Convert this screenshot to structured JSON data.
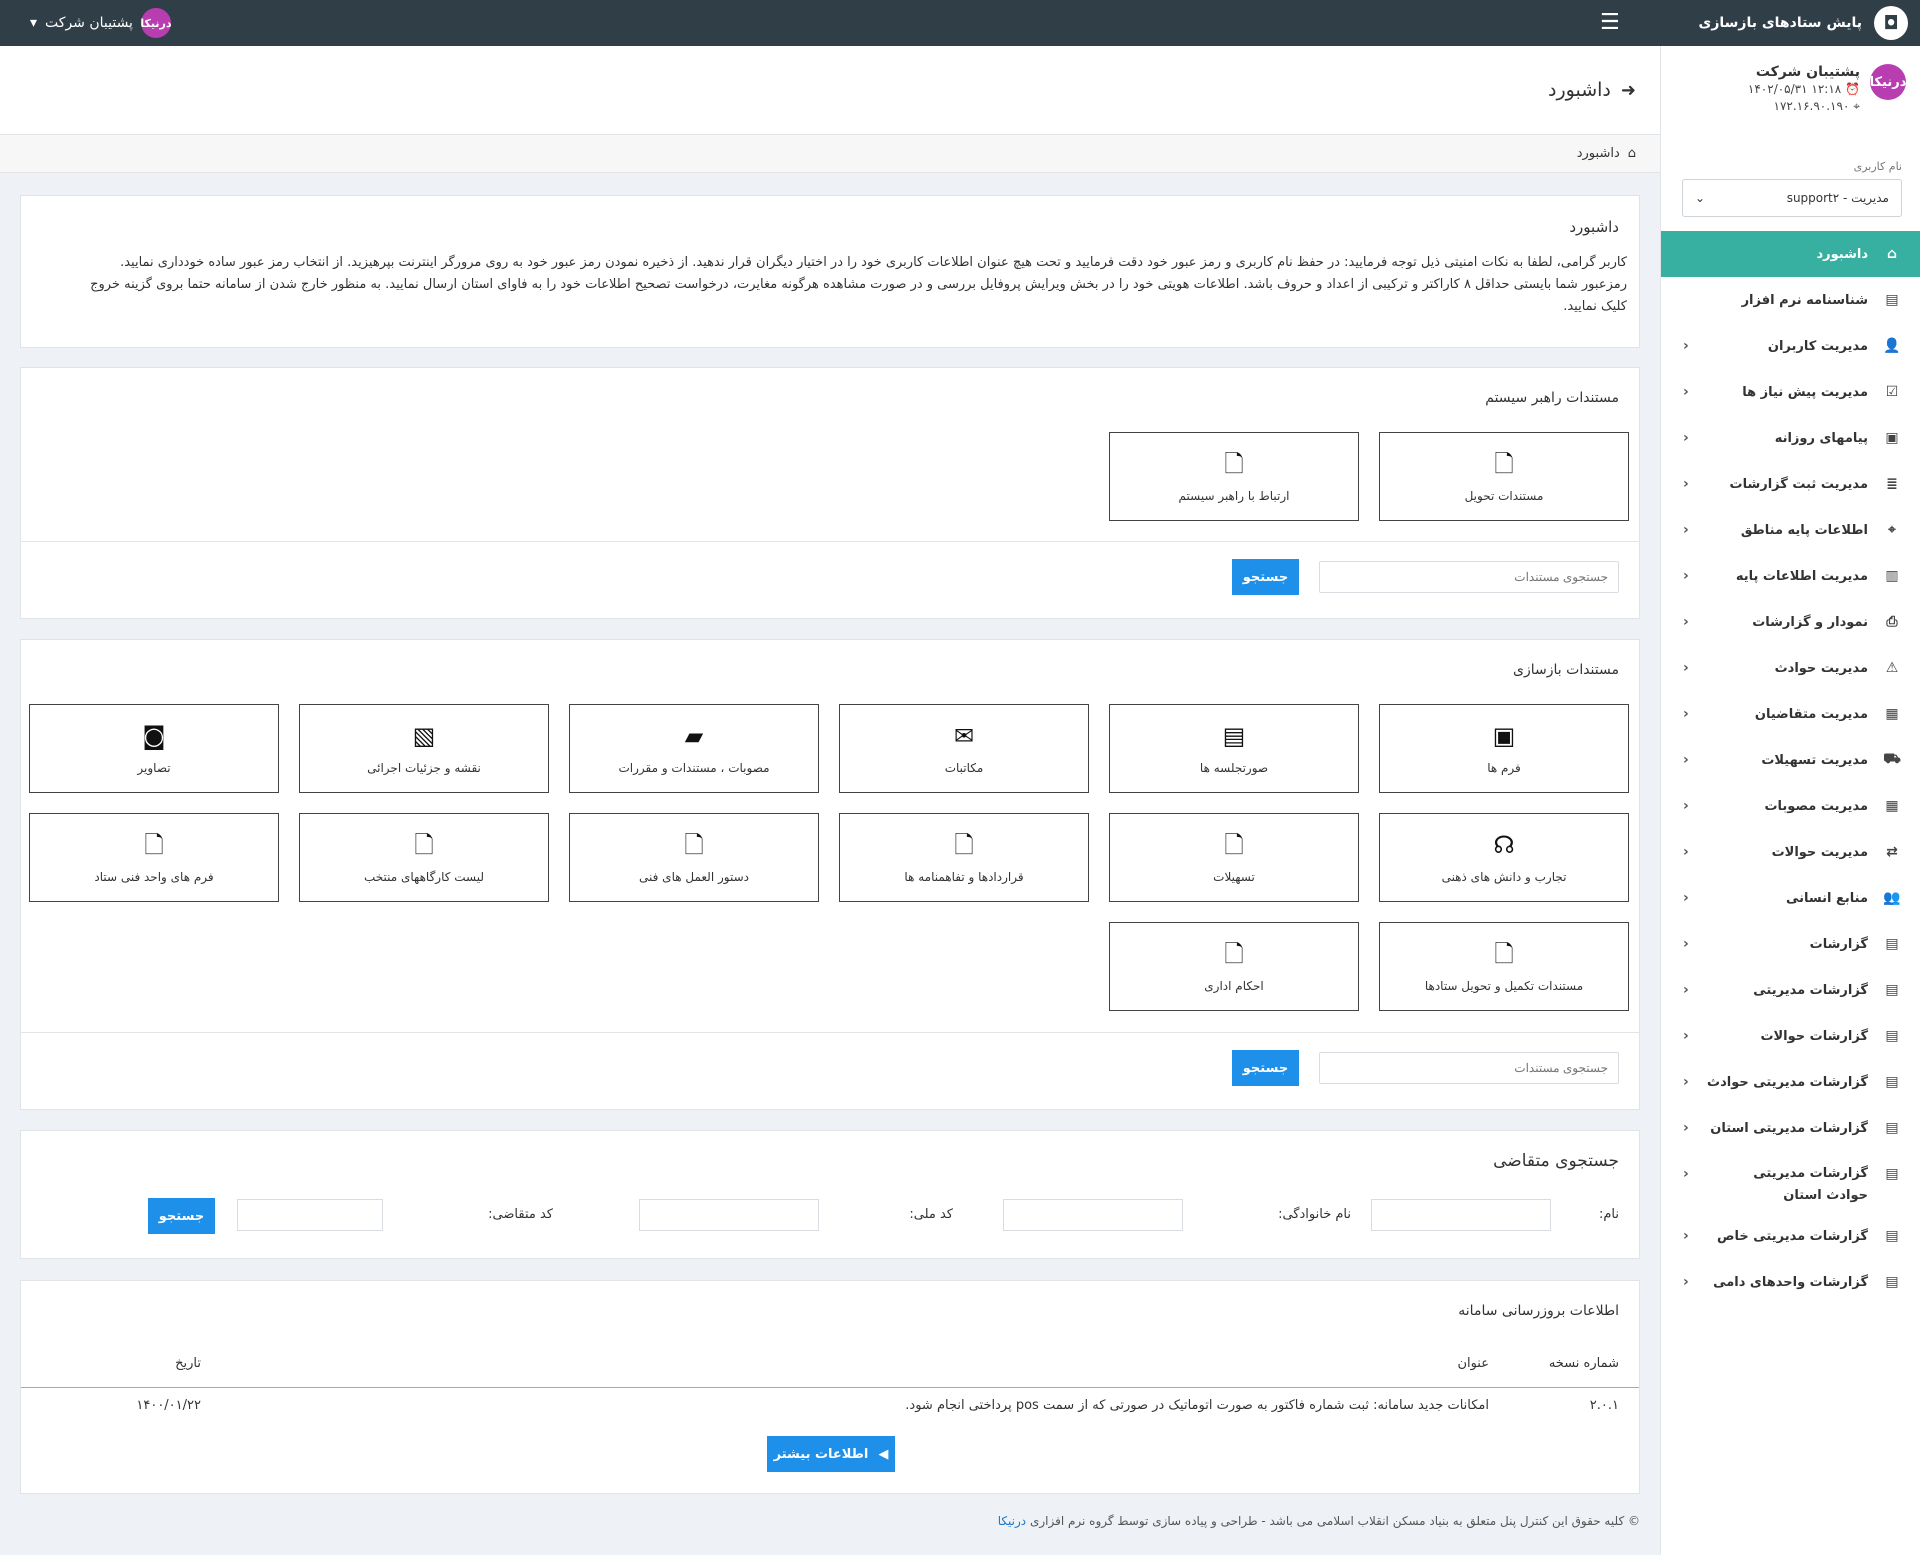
{
  "topbar": {
    "brand_title": "پایش ستادهای بازسازی",
    "brand_logo": "logo-icon",
    "menu_icon": "hamburger-icon",
    "user_name": "پشتیبان شرکت",
    "user_logo_text": "درنیکا"
  },
  "sidebar": {
    "profile_name": "پشتیبان شرکت",
    "profile_datetime": "۱۲:۱۸ ۱۴۰۲/۰۵/۳۱",
    "profile_ip": "۱۷۲.۱۶.۹۰.۱۹۰",
    "username_label": "نام کاربری",
    "user_select_value": "مدیریت - support۲",
    "items": [
      {
        "label": "داشبورد",
        "icon": "home-icon",
        "active": true,
        "arrow": false
      },
      {
        "label": "شناسنامه نرم افزار",
        "icon": "id-card-icon",
        "arrow": false
      },
      {
        "label": "مدیریت کاربران",
        "icon": "users-icon",
        "arrow": true
      },
      {
        "label": "مدیریت پیش نیاز ها",
        "icon": "clipboard-icon",
        "arrow": true
      },
      {
        "label": "پیامهای روزانه",
        "icon": "message-icon",
        "arrow": true
      },
      {
        "label": "مدیریت ثبت گزارشات",
        "icon": "server-icon",
        "arrow": true
      },
      {
        "label": "اطلاعات پایه مناطق",
        "icon": "map-pin-icon",
        "arrow": true
      },
      {
        "label": "مدیریت اطلاعات پایه",
        "icon": "database-icon",
        "arrow": true
      },
      {
        "label": "نمودار و گزارشات",
        "icon": "printer-icon",
        "arrow": true
      },
      {
        "label": "مدیریت حوادث",
        "icon": "incident-icon",
        "arrow": true
      },
      {
        "label": "مدیریت متقاضیان",
        "icon": "applicants-icon",
        "arrow": true
      },
      {
        "label": "مدیریت تسهیلات",
        "icon": "facility-icon",
        "arrow": true
      },
      {
        "label": "مدیریت مصوبات",
        "icon": "approvals-icon",
        "arrow": true
      },
      {
        "label": "مدیریت حوالات",
        "icon": "transfer-icon",
        "arrow": true
      },
      {
        "label": "منابع انسانی",
        "icon": "people-icon",
        "arrow": true
      },
      {
        "label": "گزارشات",
        "icon": "report-icon",
        "arrow": true
      },
      {
        "label": "گزارشات مدیریتی",
        "icon": "report-icon",
        "arrow": true
      },
      {
        "label": "گزارشات حوالات",
        "icon": "report-icon",
        "arrow": true
      },
      {
        "label": "گزارشات مدیریتی حوادث",
        "icon": "report-icon",
        "arrow": true
      },
      {
        "label": "گزارشات مدیریتی استان",
        "icon": "report-icon",
        "arrow": true
      },
      {
        "label": "گزارشات مدیریتی حوادث استان",
        "icon": "report-icon",
        "arrow": true,
        "tall": true
      },
      {
        "label": "گزارشات مدیریتی خاص",
        "icon": "report-icon",
        "arrow": true
      },
      {
        "label": "گزارشات واحدهای دامی",
        "icon": "report-icon",
        "arrow": true
      }
    ]
  },
  "header": {
    "title": "داشبورد",
    "breadcrumb": "داشبورد"
  },
  "notice": {
    "title": "داشبورد",
    "line1": "کاربر گرامی، لطفا به نکات امنیتی ذیل توجه فرمایید: در حفظ نام کاربری و رمز عبور خود دقت فرمایید و تحت هیچ عنوان اطلاعات کاربری خود را در اختیار دیگران قرار ندهید. از ذخیره نمودن رمز عبور خود به روی مرورگر اینترنت بپرهیزید. از انتخاب رمز عبور ساده خودداری نمایید.",
    "line2": "رمزعبور شما بایستی حداقل ۸ کاراکتر و ترکیبی از اعداد و حروف باشد. اطلاعات هویتی خود را در بخش ویرایش پروفایل بررسی و در صورت مشاهده هرگونه مغایرت، درخواست تصحیح اطلاعات خود را به فاوای استان ارسال نمایید. به منظور خارج شدن از سامانه حتما بروی گزینه خروج",
    "line3": "کلیک نمایید."
  },
  "guide_docs": {
    "title": "مستندات راهبر سیستم",
    "tiles": [
      {
        "label": "مستندات تحویل",
        "icon": "document-icon"
      },
      {
        "label": "ارتباط با راهبر سیستم",
        "icon": "document-icon"
      }
    ],
    "search_placeholder": "جستجوی مستندات",
    "search_button": "جستجو"
  },
  "rebuild_docs": {
    "title": "مستندات بازسازی",
    "tiles": [
      {
        "label": "فرم ها",
        "icon": "contact-card-icon"
      },
      {
        "label": "صورتجلسه ها",
        "icon": "newspaper-icon"
      },
      {
        "label": "مکاتبات",
        "icon": "envelope-icon"
      },
      {
        "label": "مصوبات ، مستندات و مقررات",
        "icon": "folder-open-icon"
      },
      {
        "label": "نقشه و جزئیات اجرائی",
        "icon": "map-book-icon"
      },
      {
        "label": "تصاویر",
        "icon": "camera-icon"
      },
      {
        "label": "تجارب و دانش های ذهنی",
        "icon": "brain-head-icon"
      },
      {
        "label": "تسهیلات",
        "icon": "document-icon"
      },
      {
        "label": "قراردادها و تفاهمنامه ها",
        "icon": "document-icon"
      },
      {
        "label": "دستور العمل های فنی",
        "icon": "document-icon"
      },
      {
        "label": "لیست کارگاههای منتخب",
        "icon": "document-icon"
      },
      {
        "label": "فرم های واحد فنی ستاد",
        "icon": "document-icon"
      },
      {
        "label": "مستندات تکمیل و تحویل ستادها",
        "icon": "document-icon"
      },
      {
        "label": "احکام اداری",
        "icon": "document-icon"
      }
    ],
    "search_placeholder": "جستجوی مستندات",
    "search_button": "جستجو"
  },
  "applicant_search": {
    "title": "جستجوی متقاضی",
    "name_label": "نام:",
    "family_label": "نام خانوادگی:",
    "national_code_label": "کد ملی:",
    "applicant_code_label": "کد متقاضی:",
    "search_button": "جستجو"
  },
  "updates": {
    "title": "اطلاعات بروزرسانی سامانه",
    "col_version": "شماره نسخه",
    "col_title": "عنوان",
    "col_date": "تاریخ",
    "row_version": "۲.۰.۱",
    "row_title": "امکانات جدید سامانه: ثبت شماره فاکتور به صورت اتوماتیک در صورتی که از سمت pos پرداختی انجام شود.",
    "row_date": "۱۴۰۰/۰۱/۲۲",
    "more_button": "اطلاعات بیشتر"
  },
  "footer": {
    "text": "© کلیه حقوق این کنترل پنل متعلق به بنیاد مسکن انقلاب اسلامی می باشد - طراحی و پیاده سازی توسط گروه نرم افزاری",
    "link": "درنیکا"
  }
}
